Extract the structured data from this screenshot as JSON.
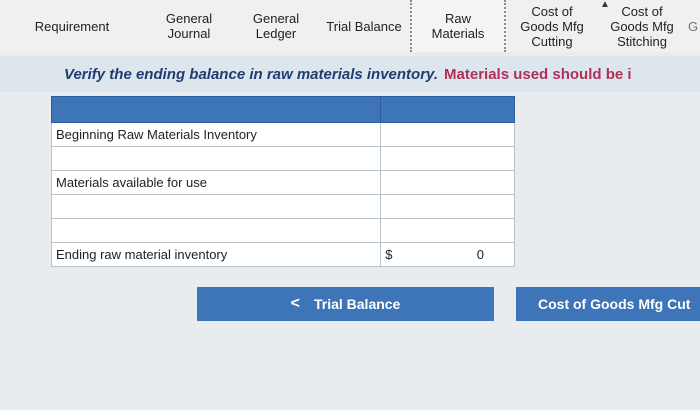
{
  "tabs": [
    {
      "label": "Requirement",
      "active": false
    },
    {
      "label": "General\nJournal",
      "active": false
    },
    {
      "label": "General\nLedger",
      "active": false
    },
    {
      "label": "Trial Balance",
      "active": false
    },
    {
      "label": "Raw\nMaterials",
      "active": true
    },
    {
      "label": "Cost of\nGoods Mfg\nCutting",
      "active": false
    },
    {
      "label": "Cost of\nGoods Mfg\nStitching",
      "active": false
    },
    {
      "label": "G",
      "active": false
    }
  ],
  "instruction": {
    "verify": "Verify the ending balance in raw materials inventory.",
    "note": "Materials used should be i"
  },
  "table": {
    "rows": [
      {
        "label": "Beginning Raw Materials Inventory",
        "amount": ""
      },
      {
        "label": "",
        "amount": ""
      },
      {
        "label": "Materials available for use",
        "amount": ""
      },
      {
        "label": "",
        "amount": ""
      },
      {
        "label": "",
        "amount": ""
      },
      {
        "label": "Ending raw material inventory",
        "currency": "$",
        "amount": "0"
      }
    ]
  },
  "nav": {
    "prev_label": "Trial Balance",
    "prev_chevron": "<",
    "next_label": "Cost of Goods Mfg Cut"
  }
}
